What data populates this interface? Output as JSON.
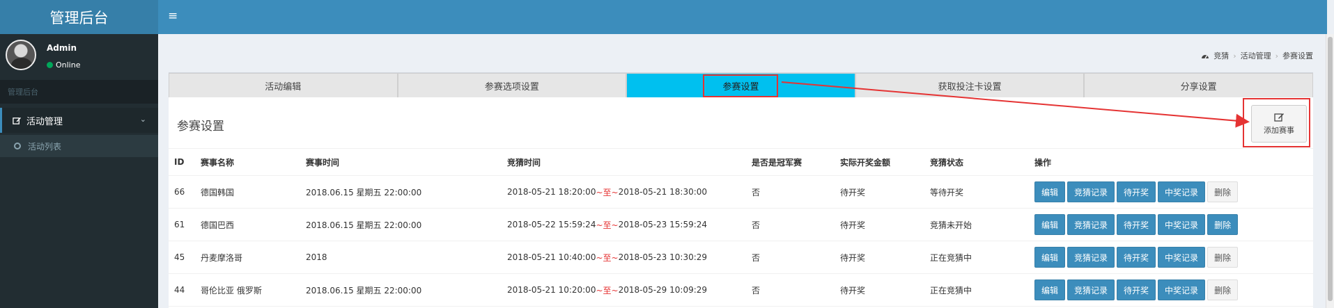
{
  "app": {
    "logo": "管理后台",
    "menu_toggle": "≡"
  },
  "user": {
    "name": "Admin",
    "status": "Online"
  },
  "sidebar": {
    "header": "管理后台",
    "menu": {
      "label": "活动管理",
      "chevron": "⌄"
    },
    "submenu": [
      {
        "label": "活动列表"
      }
    ]
  },
  "breadcrumb": {
    "items": [
      "竞猜",
      "活动管理",
      "参赛设置"
    ]
  },
  "tabs": [
    {
      "label": "活动编辑",
      "active": false
    },
    {
      "label": "参赛选项设置",
      "active": false
    },
    {
      "label": "参赛设置",
      "active": true
    },
    {
      "label": "获取投注卡设置",
      "active": false
    },
    {
      "label": "分享设置",
      "active": false
    }
  ],
  "box": {
    "title": "参赛设置",
    "add_label": "添加赛事"
  },
  "table": {
    "columns": [
      "ID",
      "赛事名称",
      "赛事时间",
      "竞猜时间",
      "是否是冠军赛",
      "实际开奖金额",
      "竞猜状态",
      "操作"
    ],
    "guess_sep": "~至~",
    "rows": [
      {
        "id": "66",
        "name": "德国韩国",
        "match_time": "2018.06.15 星期五 22:00:00",
        "guess_start": "2018-05-21 18:20:00",
        "guess_end": "2018-05-21 18:30:00",
        "champion": "否",
        "amount": "待开奖",
        "status": "等待开奖",
        "delete_style": "gray"
      },
      {
        "id": "61",
        "name": "德国巴西",
        "match_time": "2018.06.15 星期五 22:00:00",
        "guess_start": "2018-05-22 15:59:24",
        "guess_end": "2018-05-23 15:59:24",
        "champion": "否",
        "amount": "待开奖",
        "status": "竞猜未开始",
        "delete_style": "blue"
      },
      {
        "id": "45",
        "name": "丹麦摩洛哥",
        "match_time": "2018",
        "guess_start": "2018-05-21 10:40:00",
        "guess_end": "2018-05-23 10:30:29",
        "champion": "否",
        "amount": "待开奖",
        "status": "正在竞猜中",
        "delete_style": "gray"
      },
      {
        "id": "44",
        "name": "哥伦比亚 俄罗斯",
        "match_time": "2018.06.15 星期五 22:00:00",
        "guess_start": "2018-05-21 10:20:00",
        "guess_end": "2018-05-29 10:09:29",
        "champion": "否",
        "amount": "待开奖",
        "status": "正在竞猜中",
        "delete_style": "gray"
      }
    ],
    "actions": {
      "edit": "编辑",
      "records": "竞猜记录",
      "pending": "待开奖",
      "winners": "中奖记录",
      "delete": "删除"
    }
  },
  "colors": {
    "topbar": "#3c8dbc",
    "logo_bg": "#367fa9",
    "sidebar": "#222d32",
    "active_tab": "#00c0ef",
    "highlight": "#e53333",
    "btn_primary": "#3c8dbc"
  },
  "icons": {
    "dashboard": "dashboard-icon",
    "edit": "edit-icon"
  }
}
